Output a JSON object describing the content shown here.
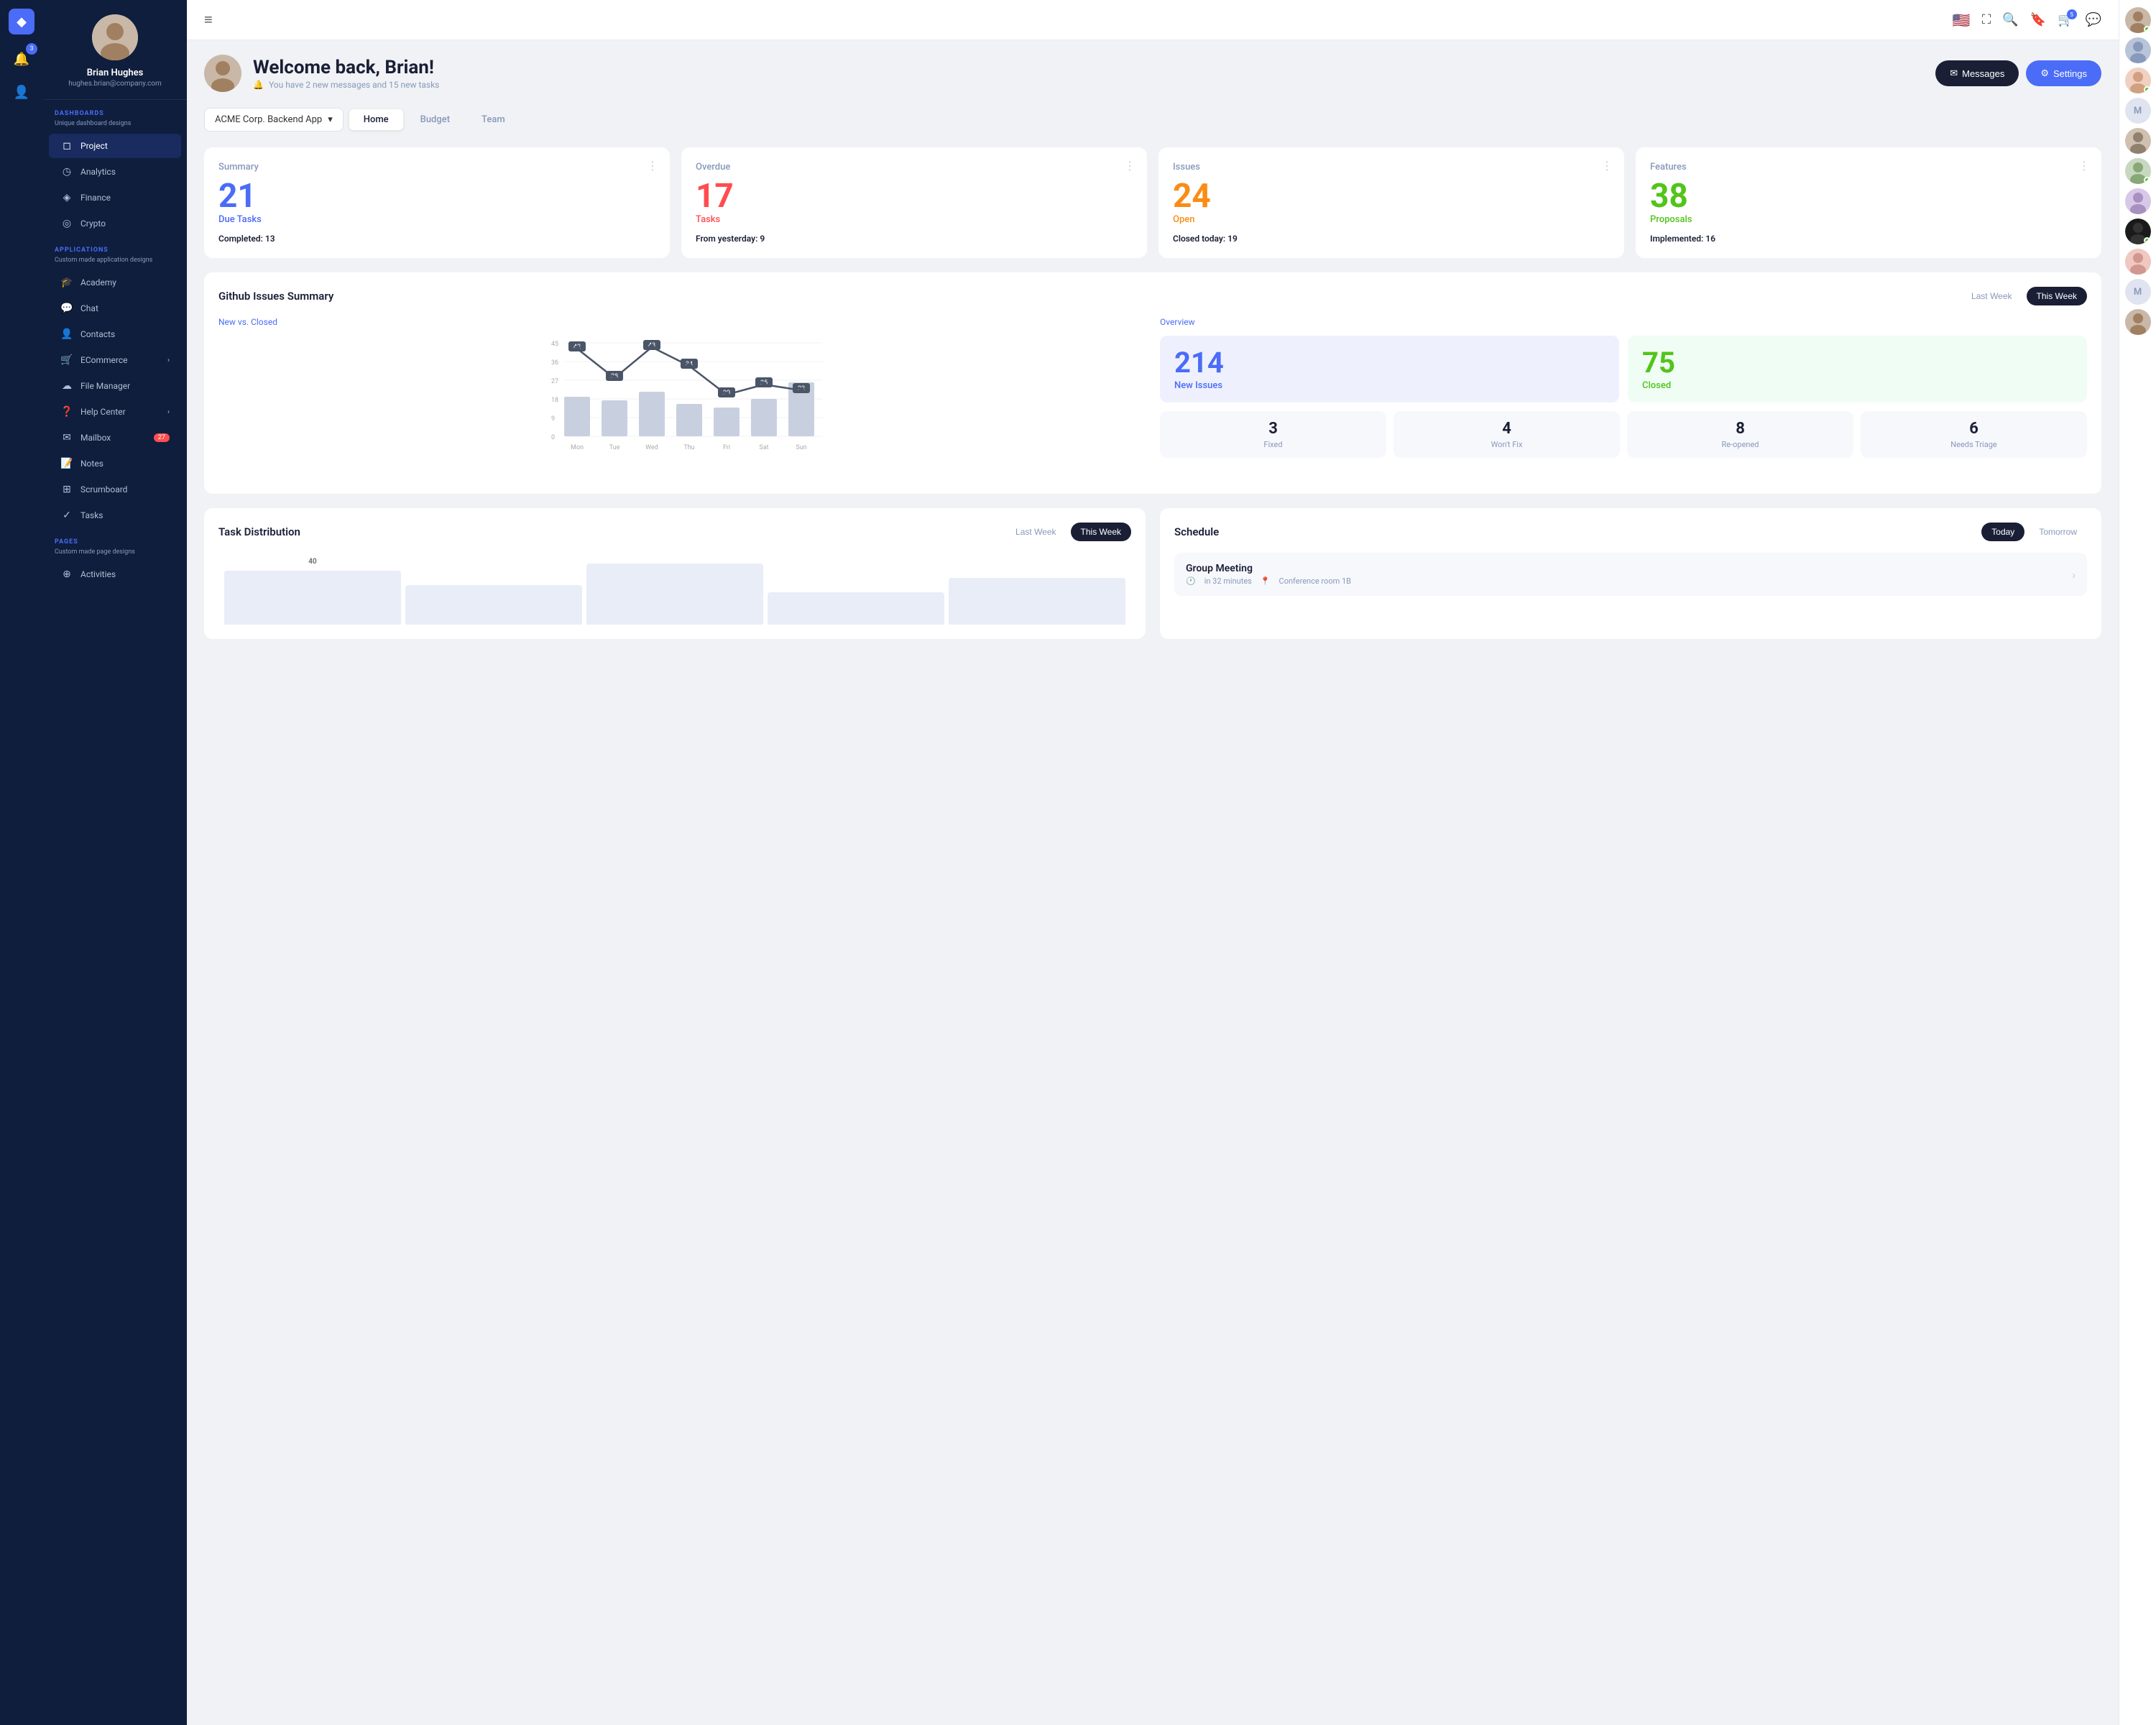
{
  "app": {
    "logo": "◆",
    "notifications_count": "3"
  },
  "sidebar": {
    "user": {
      "name": "Brian Hughes",
      "email": "hughes.brian@company.com"
    },
    "dashboards_label": "DASHBOARDS",
    "dashboards_sub": "Unique dashboard designs",
    "dashboard_items": [
      {
        "icon": "◻",
        "label": "Project",
        "active": true
      },
      {
        "icon": "◷",
        "label": "Analytics"
      },
      {
        "icon": "◈",
        "label": "Finance"
      },
      {
        "icon": "◎",
        "label": "Crypto"
      }
    ],
    "applications_label": "APPLICATIONS",
    "applications_sub": "Custom made application designs",
    "app_items": [
      {
        "icon": "🎓",
        "label": "Academy"
      },
      {
        "icon": "💬",
        "label": "Chat"
      },
      {
        "icon": "👤",
        "label": "Contacts"
      },
      {
        "icon": "🛒",
        "label": "ECommerce",
        "chevron": "›"
      },
      {
        "icon": "☁",
        "label": "File Manager"
      },
      {
        "icon": "❓",
        "label": "Help Center",
        "chevron": "›"
      },
      {
        "icon": "✉",
        "label": "Mailbox",
        "badge": "27"
      },
      {
        "icon": "📝",
        "label": "Notes"
      },
      {
        "icon": "⊞",
        "label": "Scrumboard"
      },
      {
        "icon": "✓",
        "label": "Tasks"
      }
    ],
    "pages_label": "PAGES",
    "pages_sub": "Custom made page designs",
    "page_items": [
      {
        "icon": "⊕",
        "label": "Activities"
      }
    ]
  },
  "topnav": {
    "hamburger": "≡",
    "flag": "🇺🇸",
    "fullscreen_icon": "⛶",
    "search_icon": "🔍",
    "bookmark_icon": "🔖",
    "cart_icon": "🛒",
    "cart_badge": "5",
    "chat_icon": "💬"
  },
  "header": {
    "welcome": "Welcome back, Brian!",
    "subtitle": "You have 2 new messages and 15 new tasks",
    "btn_messages": "Messages",
    "btn_settings": "Settings"
  },
  "project_selector": {
    "label": "ACME Corp. Backend App"
  },
  "tabs": {
    "items": [
      "Home",
      "Budget",
      "Team"
    ],
    "active": 0
  },
  "stats": [
    {
      "title": "Summary",
      "big_num": "21",
      "num_color": "blue",
      "num_label": "Due Tasks",
      "num_label_color": "blue",
      "sub_key": "Completed:",
      "sub_val": "13"
    },
    {
      "title": "Overdue",
      "big_num": "17",
      "num_color": "red",
      "num_label": "Tasks",
      "num_label_color": "red",
      "sub_key": "From yesterday:",
      "sub_val": "9"
    },
    {
      "title": "Issues",
      "big_num": "24",
      "num_color": "orange",
      "num_label": "Open",
      "num_label_color": "orange",
      "sub_key": "Closed today:",
      "sub_val": "19"
    },
    {
      "title": "Features",
      "big_num": "38",
      "num_color": "green",
      "num_label": "Proposals",
      "num_label_color": "green",
      "sub_key": "Implemented:",
      "sub_val": "16"
    }
  ],
  "github": {
    "title": "Github Issues Summary",
    "last_week": "Last Week",
    "this_week": "This Week",
    "chart_subtitle": "New vs. Closed",
    "days": [
      "Mon",
      "Tue",
      "Wed",
      "Thu",
      "Fri",
      "Sat",
      "Sun"
    ],
    "line_values": [
      42,
      28,
      43,
      34,
      20,
      25,
      22
    ],
    "bar_heights": [
      60,
      55,
      70,
      50,
      40,
      55,
      80
    ],
    "y_labels": [
      "45",
      "36",
      "27",
      "18",
      "9",
      "0"
    ],
    "overview_title": "Overview",
    "new_issues": "214",
    "new_issues_label": "New Issues",
    "closed": "75",
    "closed_label": "Closed",
    "mini_cards": [
      {
        "num": "3",
        "label": "Fixed"
      },
      {
        "num": "4",
        "label": "Won't Fix"
      },
      {
        "num": "8",
        "label": "Re-opened"
      },
      {
        "num": "6",
        "label": "Needs Triage"
      }
    ]
  },
  "task_dist": {
    "title": "Task Distribution",
    "last_week": "Last Week",
    "this_week": "This Week"
  },
  "schedule": {
    "title": "Schedule",
    "today": "Today",
    "tomorrow": "Tomorrow",
    "items": [
      {
        "title": "Group Meeting",
        "time": "in 32 minutes",
        "location": "Conference room 1B"
      }
    ]
  },
  "right_sidebar": {
    "users": [
      {
        "type": "avatar",
        "online": true
      },
      {
        "type": "avatar",
        "online": false
      },
      {
        "type": "avatar",
        "online": true
      },
      {
        "type": "placeholder",
        "letter": "M"
      },
      {
        "type": "avatar",
        "online": false
      },
      {
        "type": "avatar",
        "online": true
      },
      {
        "type": "avatar",
        "online": false
      },
      {
        "type": "avatar",
        "online": true
      },
      {
        "type": "avatar",
        "online": false
      },
      {
        "type": "placeholder",
        "letter": "M"
      },
      {
        "type": "avatar",
        "online": false
      }
    ]
  }
}
